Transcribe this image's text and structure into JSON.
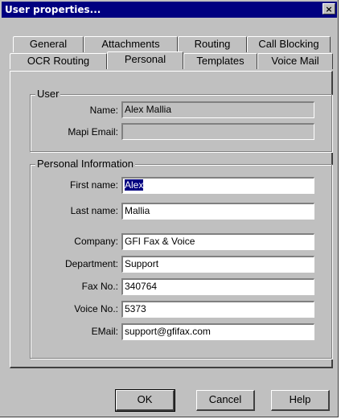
{
  "window": {
    "title": "User properties...",
    "close_glyph": "×"
  },
  "tabs": {
    "row1": [
      "General",
      "Attachments",
      "Routing",
      "Call Blocking"
    ],
    "row2": [
      "OCR Routing",
      "Personal",
      "Templates",
      "Voice Mail"
    ],
    "active": "Personal"
  },
  "user_group": {
    "title": "User",
    "name_label": "Name:",
    "name_value": "Alex Mallia",
    "mapi_label": "Mapi Email:",
    "mapi_value": ""
  },
  "personal_group": {
    "title": "Personal Information",
    "first_name_label": "First name:",
    "first_name_value": "Alex",
    "last_name_label": "Last name:",
    "last_name_value": "Mallia",
    "company_label": "Company:",
    "company_value": "GFI Fax & Voice",
    "department_label": "Department:",
    "department_value": "Support",
    "fax_label": "Fax No.:",
    "fax_value": "340764",
    "voice_label": "Voice No.:",
    "voice_value": "5373",
    "email_label": "EMail:",
    "email_value": "support@gfifax.com"
  },
  "buttons": {
    "ok": "OK",
    "cancel": "Cancel",
    "help": "Help"
  }
}
